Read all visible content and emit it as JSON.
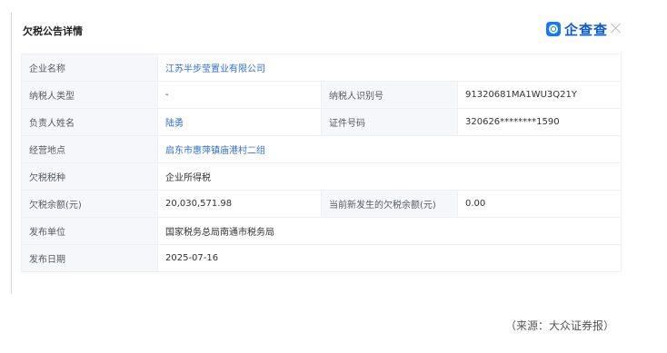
{
  "header": {
    "title": "欠税公告详情",
    "brand": "企查查"
  },
  "rows": {
    "company": {
      "label": "企业名称",
      "value": "江苏半步莹置业有限公司"
    },
    "taxpayer_type": {
      "label": "纳税人类型",
      "value": "-"
    },
    "taxpayer_id": {
      "label": "纳税人识别号",
      "value": "91320681MA1WU3Q21Y"
    },
    "responsible": {
      "label": "负责人姓名",
      "value": "陆勇"
    },
    "id_number": {
      "label": "证件号码",
      "value": "320626********1590"
    },
    "address": {
      "label": "经营地点",
      "value": "启东市惠萍镇庙港村二组"
    },
    "tax_type": {
      "label": "欠税税种",
      "value": "企业所得税"
    },
    "balance": {
      "label": "欠税余额(元)",
      "value": "20,030,571.98"
    },
    "new_balance": {
      "label": "当前新发生的欠税余额(元)",
      "value": "0.00"
    },
    "publisher": {
      "label": "发布单位",
      "value": "国家税务总局南通市税务局"
    },
    "publish_date": {
      "label": "发布日期",
      "value": "2025-07-16"
    }
  },
  "source": "（来源：大众证券报）",
  "colors": {
    "link": "#2f6fd6",
    "brand": "#0c5bd6",
    "label_bg": "#f5f7fa",
    "border": "#eef0f3"
  },
  "icons": {
    "brand_logo": "qichacha-logo-icon",
    "close": "close-icon"
  }
}
